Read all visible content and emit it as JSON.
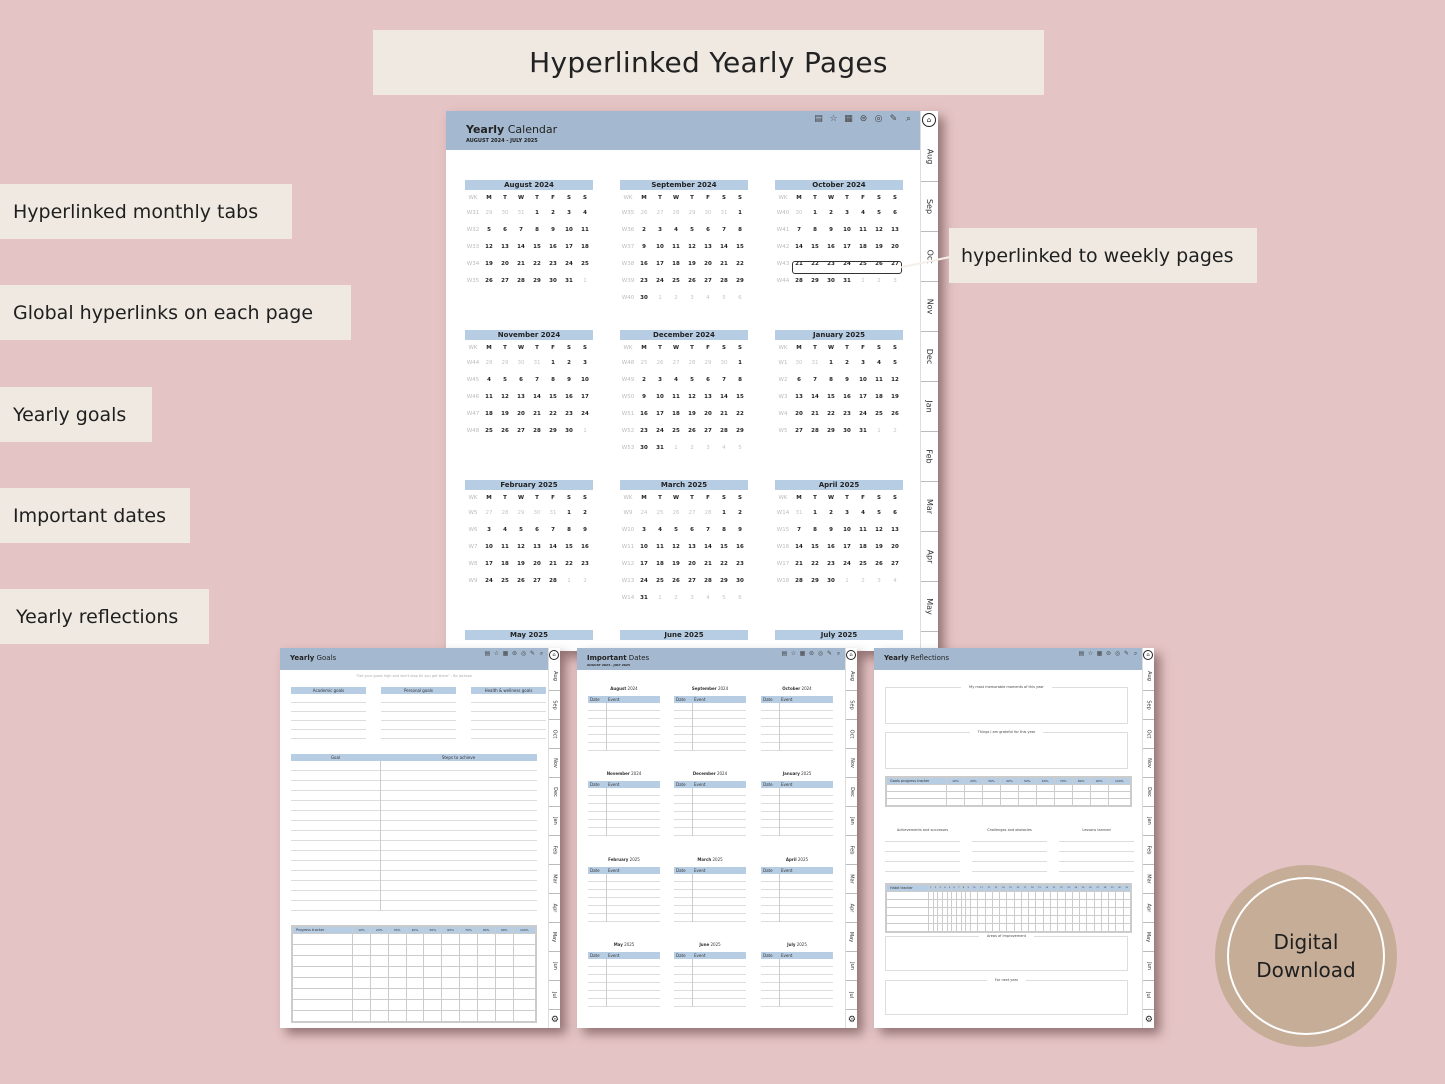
{
  "banner": {
    "title": "Hyperlinked Yearly Pages"
  },
  "features": [
    {
      "label": "Hyperlinked monthly tabs"
    },
    {
      "label": "Global hyperlinks on each page"
    },
    {
      "label": "Yearly goals"
    },
    {
      "label": "Important dates"
    },
    {
      "label": "Yearly reflections"
    }
  ],
  "callout": {
    "label": "hyperlinked to weekly pages"
  },
  "badge": {
    "line1": "Digital",
    "line2": "Download"
  },
  "colors": {
    "background": "#e5c4c5",
    "label_bg": "#efe9e2",
    "header_blue": "#a4b9cf",
    "month_blue": "#b7cde4",
    "badge": "#c5ad97"
  },
  "toolbar_icons": [
    "notes-icon",
    "star-icon",
    "calendar-icon",
    "sheet-icon",
    "target-icon",
    "edit-icon",
    "search-icon"
  ],
  "tabs": [
    "Aug",
    "Sep",
    "Oct",
    "Nov",
    "Dec",
    "Jan",
    "Feb",
    "Mar",
    "Apr",
    "May",
    "Jun",
    "Jul"
  ],
  "yearly_calendar": {
    "title_bold": "Yearly",
    "title_rest": " Calendar",
    "subtitle": "AUGUST 2024 - JULY 2025",
    "dow": [
      "WK",
      "M",
      "T",
      "W",
      "T",
      "F",
      "S",
      "S"
    ],
    "highlighted_week": "W43",
    "months": [
      {
        "name": "August 2024",
        "weeks": [
          [
            "W31",
            "29*",
            "30*",
            "31*",
            "1",
            "2",
            "3",
            "4"
          ],
          [
            "W32",
            "5",
            "6",
            "7",
            "8",
            "9",
            "10",
            "11"
          ],
          [
            "W33",
            "12",
            "13",
            "14",
            "15",
            "16",
            "17",
            "18"
          ],
          [
            "W34",
            "19",
            "20",
            "21",
            "22",
            "23",
            "24",
            "25"
          ],
          [
            "W35",
            "26",
            "27",
            "28",
            "29",
            "30",
            "31",
            "1*"
          ]
        ]
      },
      {
        "name": "September 2024",
        "weeks": [
          [
            "W35",
            "26*",
            "27*",
            "28*",
            "29*",
            "30*",
            "31*",
            "1"
          ],
          [
            "W36",
            "2",
            "3",
            "4",
            "5",
            "6",
            "7",
            "8"
          ],
          [
            "W37",
            "9",
            "10",
            "11",
            "12",
            "13",
            "14",
            "15"
          ],
          [
            "W38",
            "16",
            "17",
            "18",
            "19",
            "20",
            "21",
            "22"
          ],
          [
            "W39",
            "23",
            "24",
            "25",
            "26",
            "27",
            "28",
            "29"
          ],
          [
            "W40",
            "30",
            "1*",
            "2*",
            "3*",
            "4*",
            "5*",
            "6*"
          ]
        ]
      },
      {
        "name": "October 2024",
        "weeks": [
          [
            "W40",
            "30*",
            "1",
            "2",
            "3",
            "4",
            "5",
            "6"
          ],
          [
            "W41",
            "7",
            "8",
            "9",
            "10",
            "11",
            "12",
            "13"
          ],
          [
            "W42",
            "14",
            "15",
            "16",
            "17",
            "18",
            "19",
            "20"
          ],
          [
            "W43",
            "21",
            "22",
            "23",
            "24",
            "25",
            "26",
            "27"
          ],
          [
            "W44",
            "28",
            "29",
            "30",
            "31",
            "1*",
            "2*",
            "3*"
          ]
        ]
      },
      {
        "name": "November 2024",
        "weeks": [
          [
            "W44",
            "28*",
            "29*",
            "30*",
            "31*",
            "1",
            "2",
            "3"
          ],
          [
            "W45",
            "4",
            "5",
            "6",
            "7",
            "8",
            "9",
            "10"
          ],
          [
            "W46",
            "11",
            "12",
            "13",
            "14",
            "15",
            "16",
            "17"
          ],
          [
            "W47",
            "18",
            "19",
            "20",
            "21",
            "22",
            "23",
            "24"
          ],
          [
            "W48",
            "25",
            "26",
            "27",
            "28",
            "29",
            "30",
            "1*"
          ]
        ]
      },
      {
        "name": "December 2024",
        "weeks": [
          [
            "W48",
            "25*",
            "26*",
            "27*",
            "28*",
            "29*",
            "30*",
            "1"
          ],
          [
            "W49",
            "2",
            "3",
            "4",
            "5",
            "6",
            "7",
            "8"
          ],
          [
            "W50",
            "9",
            "10",
            "11",
            "12",
            "13",
            "14",
            "15"
          ],
          [
            "W51",
            "16",
            "17",
            "18",
            "19",
            "20",
            "21",
            "22"
          ],
          [
            "W52",
            "23",
            "24",
            "25",
            "26",
            "27",
            "28",
            "29"
          ],
          [
            "W53",
            "30",
            "31",
            "1*",
            "2*",
            "3*",
            "4*",
            "5*"
          ]
        ]
      },
      {
        "name": "January 2025",
        "weeks": [
          [
            "W1",
            "30*",
            "31*",
            "1",
            "2",
            "3",
            "4",
            "5"
          ],
          [
            "W2",
            "6",
            "7",
            "8",
            "9",
            "10",
            "11",
            "12"
          ],
          [
            "W3",
            "13",
            "14",
            "15",
            "16",
            "17",
            "18",
            "19"
          ],
          [
            "W4",
            "20",
            "21",
            "22",
            "23",
            "24",
            "25",
            "26"
          ],
          [
            "W5",
            "27",
            "28",
            "29",
            "30",
            "31",
            "1*",
            "2*"
          ]
        ]
      },
      {
        "name": "February 2025",
        "weeks": [
          [
            "W5",
            "27*",
            "28*",
            "29*",
            "30*",
            "31*",
            "1",
            "2"
          ],
          [
            "W6",
            "3",
            "4",
            "5",
            "6",
            "7",
            "8",
            "9"
          ],
          [
            "W7",
            "10",
            "11",
            "12",
            "13",
            "14",
            "15",
            "16"
          ],
          [
            "W8",
            "17",
            "18",
            "19",
            "20",
            "21",
            "22",
            "23"
          ],
          [
            "W9",
            "24",
            "25",
            "26",
            "27",
            "28",
            "1*",
            "2*"
          ]
        ]
      },
      {
        "name": "March 2025",
        "weeks": [
          [
            "W9",
            "24*",
            "25*",
            "26*",
            "27*",
            "28*",
            "1",
            "2"
          ],
          [
            "W10",
            "3",
            "4",
            "5",
            "6",
            "7",
            "8",
            "9"
          ],
          [
            "W11",
            "10",
            "11",
            "12",
            "13",
            "14",
            "15",
            "16"
          ],
          [
            "W12",
            "17",
            "18",
            "19",
            "20",
            "21",
            "22",
            "23"
          ],
          [
            "W13",
            "24",
            "25",
            "26",
            "27",
            "28",
            "29",
            "30"
          ],
          [
            "W14",
            "31",
            "1*",
            "2*",
            "3*",
            "4*",
            "5*",
            "6*"
          ]
        ]
      },
      {
        "name": "April 2025",
        "weeks": [
          [
            "W14",
            "31*",
            "1",
            "2",
            "3",
            "4",
            "5",
            "6"
          ],
          [
            "W15",
            "7",
            "8",
            "9",
            "10",
            "11",
            "12",
            "13"
          ],
          [
            "W16",
            "14",
            "15",
            "16",
            "17",
            "18",
            "19",
            "20"
          ],
          [
            "W17",
            "21",
            "22",
            "23",
            "24",
            "25",
            "26",
            "27"
          ],
          [
            "W18",
            "28",
            "29",
            "30",
            "1*",
            "2*",
            "3*",
            "4*"
          ]
        ]
      },
      {
        "name": "May 2025",
        "weeks": []
      },
      {
        "name": "June 2025",
        "weeks": []
      },
      {
        "name": "July 2025",
        "weeks": []
      }
    ]
  },
  "yearly_goals": {
    "title_bold": "Yearly",
    "title_rest": " Goals",
    "quote": "\"Set your goals high and don't stop till you get there\" - Bo Jackson",
    "categories": [
      "Academic goals",
      "Personal goals",
      "Health & wellness goals"
    ],
    "goal_header": "Goal",
    "steps_header": "Steps to achieve",
    "progress_header": "Progress tracker",
    "progress_cols": [
      "10%",
      "20%",
      "30%",
      "40%",
      "50%",
      "60%",
      "70%",
      "80%",
      "90%",
      "100%"
    ]
  },
  "important_dates": {
    "title_bold": "Important",
    "title_rest": " Dates",
    "subtitle": "AUGUST 2024 - JULY 2025",
    "date_header": "Date",
    "event_header": "Event",
    "months": [
      {
        "bold": "August",
        "year": " 2024"
      },
      {
        "bold": "September",
        "year": " 2024"
      },
      {
        "bold": "October",
        "year": " 2024"
      },
      {
        "bold": "November",
        "year": " 2024"
      },
      {
        "bold": "December",
        "year": " 2024"
      },
      {
        "bold": "January",
        "year": " 2025"
      },
      {
        "bold": "February",
        "year": " 2025"
      },
      {
        "bold": "March",
        "year": " 2025"
      },
      {
        "bold": "April",
        "year": " 2025"
      },
      {
        "bold": "May",
        "year": " 2025"
      },
      {
        "bold": "June",
        "year": " 2025"
      },
      {
        "bold": "July",
        "year": " 2025"
      }
    ]
  },
  "yearly_reflections": {
    "title_bold": "Yearly",
    "title_rest": " Reflections",
    "memorable": "My most memorable moments of this year",
    "grateful": "Things I am grateful for this year",
    "goals_tracker": "Goals progress tracker",
    "tracker_cols": [
      "10%",
      "20%",
      "30%",
      "40%",
      "50%",
      "60%",
      "70%",
      "80%",
      "90%",
      "100%"
    ],
    "sections": [
      "Achievements and successes",
      "Challenges and obstacles",
      "Lessons learned"
    ],
    "habit_tracker": "Habit tracker",
    "improvement": "Areas of improvement",
    "next_year": "For next year"
  }
}
